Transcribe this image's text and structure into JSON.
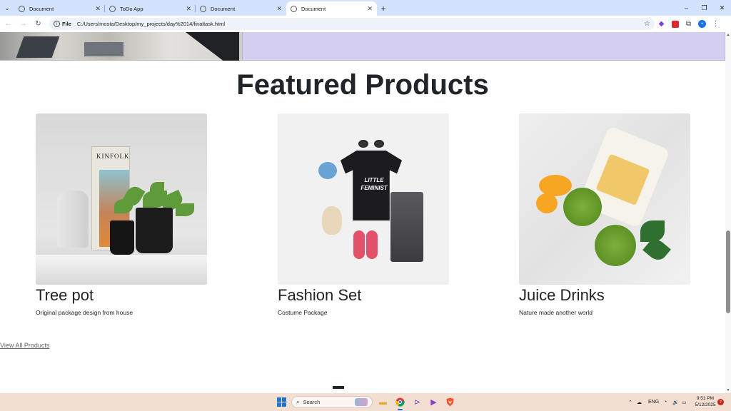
{
  "browser": {
    "tabs": [
      {
        "title": "Document",
        "active": false
      },
      {
        "title": "ToDo App",
        "active": false
      },
      {
        "title": "Document",
        "active": false
      },
      {
        "title": "Document",
        "active": true
      }
    ],
    "new_tab_label": "+",
    "address": {
      "scheme_label": "File",
      "url": "C:/Users/mosta/Desktop/my_projects/day%2014/finaltask.html"
    }
  },
  "page": {
    "section_title": "Featured Products",
    "products": [
      {
        "name": "Tree pot",
        "description": "Original package design from house"
      },
      {
        "name": "Fashion Set",
        "description": "Costume Package"
      },
      {
        "name": "Juice Drinks",
        "description": "Nature made another world"
      }
    ],
    "tee_print": "LITTLE FEMINIST",
    "book_title": "KINFOLK",
    "view_all_label": "View All Products"
  },
  "taskbar": {
    "search_placeholder": "Search",
    "language": "ENG",
    "time": "9:51 PM",
    "date": "5/12/2025",
    "notification_count": "7"
  },
  "colors": {
    "tabstrip": "#d3e3fd",
    "hero_panel": "#d4cff0",
    "taskbar": "#f3dfd2",
    "windows_blue": "#1f73d6"
  }
}
